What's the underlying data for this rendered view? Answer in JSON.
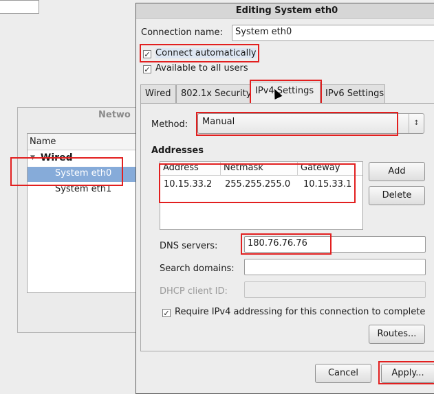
{
  "background_window": {
    "title": "Netwo",
    "column_header": "Name",
    "group": "Wired",
    "connections": [
      "System eth0",
      "System eth1"
    ]
  },
  "dialog": {
    "title": "Editing System eth0",
    "connection_name_label": "Connection name:",
    "connection_name_value": "System eth0",
    "connect_automatically": {
      "label": "Connect automatically",
      "checked": true
    },
    "available_to_all": {
      "label": "Available to all users",
      "checked": true
    },
    "tabs": [
      {
        "label": "Wired"
      },
      {
        "label": "802.1x Security"
      },
      {
        "label": "IPv4 Settings",
        "active": true
      },
      {
        "label": "IPv6 Settings"
      }
    ],
    "method_label": "Method:",
    "method_value": "Manual",
    "addresses_heading": "Addresses",
    "address_columns": [
      "Address",
      "Netmask",
      "Gateway"
    ],
    "address_rows": [
      [
        "10.15.33.2",
        "255.255.255.0",
        "10.15.33.1"
      ]
    ],
    "add_button": "Add",
    "delete_button": "Delete",
    "dns_label": "DNS servers:",
    "dns_value": "180.76.76.76",
    "search_domains_label": "Search domains:",
    "search_domains_value": "",
    "dhcp_label": "DHCP client ID:",
    "dhcp_value": "",
    "require_ipv4": {
      "label": "Require IPv4 addressing for this connection to complete",
      "checked": true
    },
    "routes_button": "Routes...",
    "cancel_button": "Cancel",
    "apply_button": "Apply..."
  },
  "colors": {
    "highlight_box": "#e21f1f",
    "selection": "#86abd9"
  }
}
